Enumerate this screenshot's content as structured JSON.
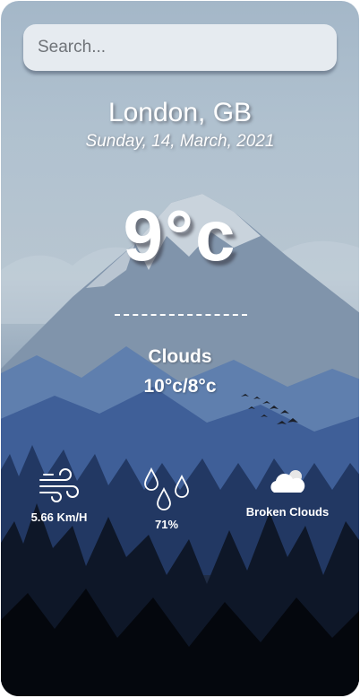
{
  "search": {
    "placeholder": "Search..."
  },
  "location": "London, GB",
  "date": "Sunday, 14, March, 2021",
  "temperature": "9°c",
  "condition": "Clouds",
  "temp_range": "10°c/8°c",
  "stats": {
    "wind": {
      "value": "5.66 Km/H",
      "icon": "wind-icon"
    },
    "humidity": {
      "value": "71%",
      "icon": "water-drops-icon"
    },
    "description": {
      "value": "Broken Clouds",
      "icon": "cloud-icon"
    }
  },
  "colors": {
    "text": "#ffffff",
    "search_bg": "#e6ebf0"
  }
}
